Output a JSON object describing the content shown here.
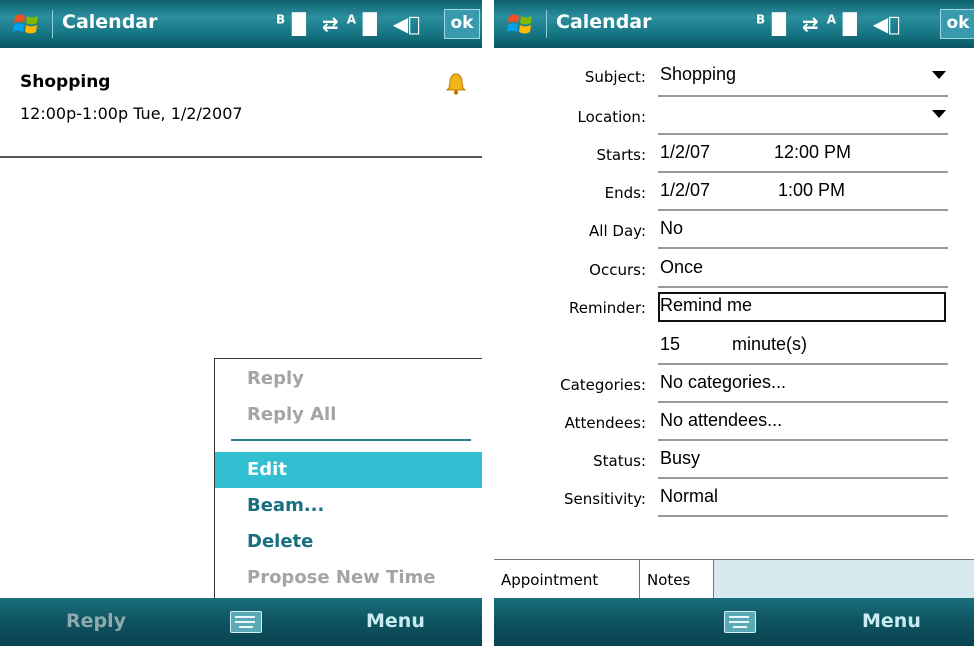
{
  "left": {
    "title": "Calendar",
    "ok_label": "ok",
    "appointment": {
      "subject": "Shopping",
      "time": "12:00p-1:00p Tue, 1/2/2007"
    },
    "menu": {
      "items": [
        {
          "label": "Reply",
          "state": "disabled"
        },
        {
          "label": "Reply All",
          "state": "disabled"
        },
        {
          "label": "Edit",
          "state": "selected"
        },
        {
          "label": "Beam...",
          "state": "enabled"
        },
        {
          "label": "Delete",
          "state": "enabled"
        },
        {
          "label": "Propose New Time",
          "state": "disabled"
        }
      ]
    },
    "softkeys": {
      "left": "Reply",
      "right": "Menu"
    },
    "status_icons": [
      "bluetooth-signal-icon",
      "data-sync-icon",
      "signal-strength-icon",
      "speaker-icon"
    ]
  },
  "right": {
    "title": "Calendar",
    "ok_label": "ok",
    "form": {
      "subject_label": "Subject:",
      "subject_value": "Shopping",
      "location_label": "Location:",
      "location_value": "",
      "starts_label": "Starts:",
      "starts_date": "1/2/07",
      "starts_time": "12:00 PM",
      "ends_label": "Ends:",
      "ends_date": "1/2/07",
      "ends_time": "1:00 PM",
      "allday_label": "All Day:",
      "allday_value": "No",
      "occurs_label": "Occurs:",
      "occurs_value": "Once",
      "reminder_label": "Reminder:",
      "reminder_value": "Remind me",
      "reminder_minutes": "15",
      "reminder_unit": "minute(s)",
      "categories_label": "Categories:",
      "categories_value": "No categories...",
      "attendees_label": "Attendees:",
      "attendees_value": "No attendees...",
      "status_label": "Status:",
      "status_value": "Busy",
      "sensitivity_label": "Sensitivity:",
      "sensitivity_value": "Normal"
    },
    "tabs": [
      {
        "label": "Appointment",
        "active": true
      },
      {
        "label": "Notes",
        "active": false
      }
    ],
    "softkeys": {
      "left": "",
      "right": "Menu"
    }
  },
  "colors": {
    "titlebar": "#1a7f8e",
    "menu_highlight": "#33bfd2",
    "menu_enabled_text": "#176f7f",
    "menu_disabled_text": "#a4a4a4"
  }
}
